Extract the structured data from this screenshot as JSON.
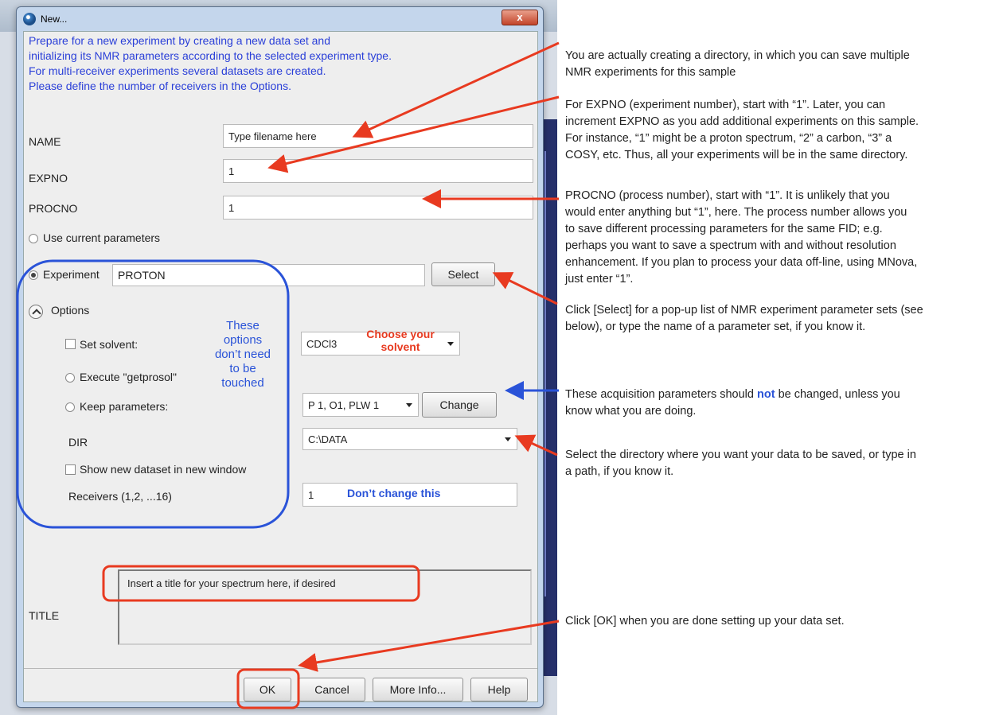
{
  "dialog": {
    "title": "New...",
    "close_label": "x",
    "intro_lines": [
      "Prepare for a new experiment by creating a new data set and",
      "initializing its NMR parameters according to the selected experiment type.",
      "For multi-receiver experiments several datasets are created.",
      "Please define the number of receivers in the Options."
    ],
    "name_label": "NAME",
    "name_value": "Type filename here",
    "expno_label": "EXPNO",
    "expno_value": "1",
    "procno_label": "PROCNO",
    "procno_value": "1",
    "use_current_label": "Use current parameters",
    "experiment_label": "Experiment",
    "experiment_value": "PROTON",
    "select_button": "Select",
    "options_label": "Options",
    "set_solvent_label": "Set solvent:",
    "solvent_value": "CDCl3",
    "execute_label": "Execute \"getprosol\"",
    "keep_params_label": "Keep parameters:",
    "keep_params_value": "P 1, O1, PLW 1",
    "change_button": "Change",
    "dir_label": "DIR",
    "dir_value": "C:\\DATA",
    "show_new_label": "Show new dataset in new window",
    "receivers_label": "Receivers (1,2, ...16)",
    "receivers_value": "1",
    "title_label": "TITLE",
    "title_value": "Insert a title for your spectrum here, if desired",
    "ok_button": "OK",
    "cancel_button": "Cancel",
    "more_info_button": "More Info...",
    "help_button": "Help"
  },
  "overlays": {
    "choose_solvent": [
      "Choose your",
      "solvent"
    ],
    "options_note": [
      "These",
      "options",
      "don’t need",
      "to be",
      "touched"
    ],
    "dont_change": "Don’t change this"
  },
  "annotations": {
    "directory": [
      "You are actually creating a directory, in which you can save multiple",
      "NMR experiments for this sample"
    ],
    "expno": [
      "For EXPNO (experiment number), start with “1”.  Later, you can",
      "increment EXPNO as you add additional experiments on this sample.",
      "For instance, “1” might be a proton spectrum, “2” a carbon, “3” a",
      "COSY, etc.  Thus, all your experiments will be in the same directory."
    ],
    "procno": [
      "PROCNO (process number), start with “1”.  It is unlikely that you",
      "would enter anything but “1”, here.  The process number allows you",
      "to save different processing parameters for the same FID; e.g.",
      "perhaps you want to save a spectrum with and without resolution",
      "enhancement.  If you plan to process your data off-line, using MNova,",
      "just enter “1”."
    ],
    "select": [
      "Click [Select] for a pop-up list of NMR experiment parameter sets (see",
      "below), or type the name of  a parameter set, if you know it."
    ],
    "acq_before": "These acquisition parameters should ",
    "acq_highlight": "not",
    "acq_after": " be changed, unless you",
    "acq_line2": "know what you are doing.",
    "dir": [
      "Select the directory where you want your data to be saved, or type in",
      "a path, if you know it."
    ],
    "ok": "Click [OK] when you are done setting up your data set."
  },
  "colors": {
    "arrow_red": "#e83a20",
    "arrow_blue": "#2a53d8",
    "intro_blue": "#2a3fd8"
  }
}
